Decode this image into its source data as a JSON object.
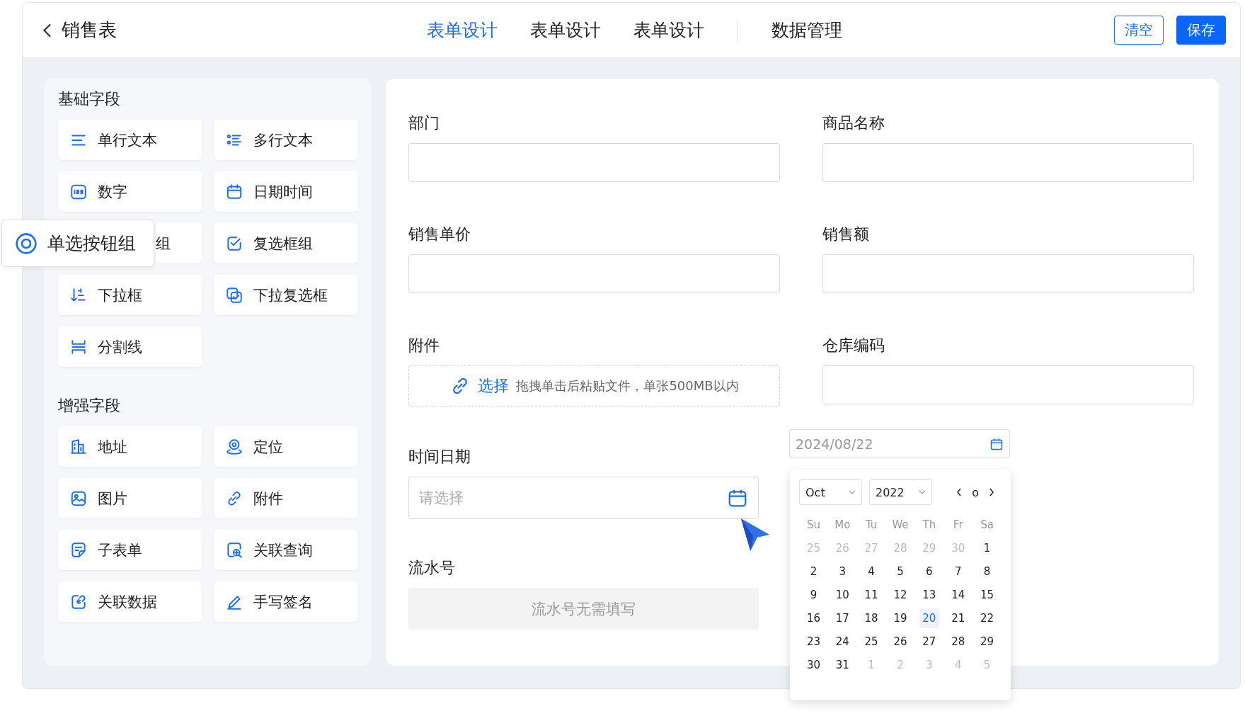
{
  "header": {
    "title": "销售表",
    "tabs": [
      {
        "label": "表单设计",
        "selected": true
      },
      {
        "label": "表单设计",
        "selected": false
      },
      {
        "label": "表单设计",
        "selected": false
      },
      {
        "label": "数据管理",
        "selected": false
      }
    ],
    "buttons": [
      {
        "label": "清空",
        "kind": "outline"
      },
      {
        "label": "保存",
        "kind": "primary"
      }
    ]
  },
  "palette": {
    "sections": [
      {
        "title": "基础字段",
        "items": [
          {
            "label": "单行文本",
            "kind": "tile"
          },
          {
            "label": "多行文本",
            "kind": "tile"
          },
          {
            "label": "数字",
            "kind": "tile"
          },
          {
            "label": "日期时间",
            "kind": "tile"
          },
          {
            "label": "组",
            "kind": "covered"
          },
          {
            "label": "复选框组",
            "kind": "tile"
          },
          {
            "label": "下拉框",
            "kind": "tile"
          },
          {
            "label": "下拉复选框",
            "kind": "tile"
          },
          {
            "label": "分割线",
            "kind": "tile"
          }
        ]
      },
      {
        "title": "增强字段",
        "items": [
          {
            "label": "地址",
            "kind": "tile"
          },
          {
            "label": "定位",
            "kind": "tile"
          },
          {
            "label": "图片",
            "kind": "tile"
          },
          {
            "label": "附件",
            "kind": "tile"
          },
          {
            "label": "子表单",
            "kind": "tile"
          },
          {
            "label": "关联查询",
            "kind": "tile"
          },
          {
            "label": "关联数据",
            "kind": "tile"
          },
          {
            "label": "手写签名",
            "kind": "tile"
          }
        ]
      }
    ]
  },
  "drag_item": {
    "label": "单选按钮组"
  },
  "form": {
    "rows": [
      [
        {
          "label": "部门",
          "kind": "text"
        },
        {
          "label": "商品名称",
          "kind": "text"
        }
      ],
      [
        {
          "label": "销售单价",
          "kind": "text"
        },
        {
          "label": "销售额",
          "kind": "text"
        }
      ],
      [
        {
          "label": "附件",
          "kind": "upload",
          "action": "选择",
          "hint": "拖拽单击后粘贴文件，单张500MB以内"
        },
        {
          "label": "仓库编码",
          "kind": "text"
        }
      ],
      [
        {
          "label": "时间日期",
          "kind": "date",
          "placeholder": "请选择"
        }
      ],
      [
        {
          "label": "流水号",
          "kind": "serial",
          "note": "流水号无需填写"
        }
      ]
    ]
  },
  "date_picker": {
    "value": "2024/08/22",
    "month": "Oct",
    "year": "2022",
    "today_mark": "o",
    "weekdays": [
      "Su",
      "Mo",
      "Tu",
      "We",
      "Th",
      "Fr",
      "Sa"
    ],
    "days": [
      {
        "label": "25",
        "outside": true,
        "selected": false
      },
      {
        "label": "26",
        "outside": true,
        "selected": false
      },
      {
        "label": "27",
        "outside": true,
        "selected": false
      },
      {
        "label": "28",
        "outside": true,
        "selected": false
      },
      {
        "label": "29",
        "outside": true,
        "selected": false
      },
      {
        "label": "30",
        "outside": true,
        "selected": false
      },
      {
        "label": "1",
        "outside": false,
        "selected": false
      },
      {
        "label": "2",
        "outside": false,
        "selected": false
      },
      {
        "label": "3",
        "outside": false,
        "selected": false
      },
      {
        "label": "4",
        "outside": false,
        "selected": false
      },
      {
        "label": "5",
        "outside": false,
        "selected": false
      },
      {
        "label": "6",
        "outside": false,
        "selected": false
      },
      {
        "label": "7",
        "outside": false,
        "selected": false
      },
      {
        "label": "8",
        "outside": false,
        "selected": false
      },
      {
        "label": "9",
        "outside": false,
        "selected": false
      },
      {
        "label": "10",
        "outside": false,
        "selected": false
      },
      {
        "label": "11",
        "outside": false,
        "selected": false
      },
      {
        "label": "12",
        "outside": false,
        "selected": false
      },
      {
        "label": "13",
        "outside": false,
        "selected": false
      },
      {
        "label": "14",
        "outside": false,
        "selected": false
      },
      {
        "label": "15",
        "outside": false,
        "selected": false
      },
      {
        "label": "16",
        "outside": false,
        "selected": false
      },
      {
        "label": "17",
        "outside": false,
        "selected": false
      },
      {
        "label": "18",
        "outside": false,
        "selected": false
      },
      {
        "label": "19",
        "outside": false,
        "selected": false
      },
      {
        "label": "20",
        "outside": false,
        "selected": true
      },
      {
        "label": "21",
        "outside": false,
        "selected": false
      },
      {
        "label": "22",
        "outside": false,
        "selected": false
      },
      {
        "label": "23",
        "outside": false,
        "selected": false
      },
      {
        "label": "24",
        "outside": false,
        "selected": false
      },
      {
        "label": "25",
        "outside": false,
        "selected": false
      },
      {
        "label": "26",
        "outside": false,
        "selected": false
      },
      {
        "label": "27",
        "outside": false,
        "selected": false
      },
      {
        "label": "28",
        "outside": false,
        "selected": false
      },
      {
        "label": "29",
        "outside": false,
        "selected": false
      },
      {
        "label": "30",
        "outside": false,
        "selected": false
      },
      {
        "label": "31",
        "outside": false,
        "selected": false
      },
      {
        "label": "1",
        "outside": true,
        "selected": false
      },
      {
        "label": "2",
        "outside": true,
        "selected": false
      },
      {
        "label": "3",
        "outside": true,
        "selected": false
      },
      {
        "label": "4",
        "outside": true,
        "selected": false
      },
      {
        "label": "5",
        "outside": true,
        "selected": false
      }
    ]
  }
}
